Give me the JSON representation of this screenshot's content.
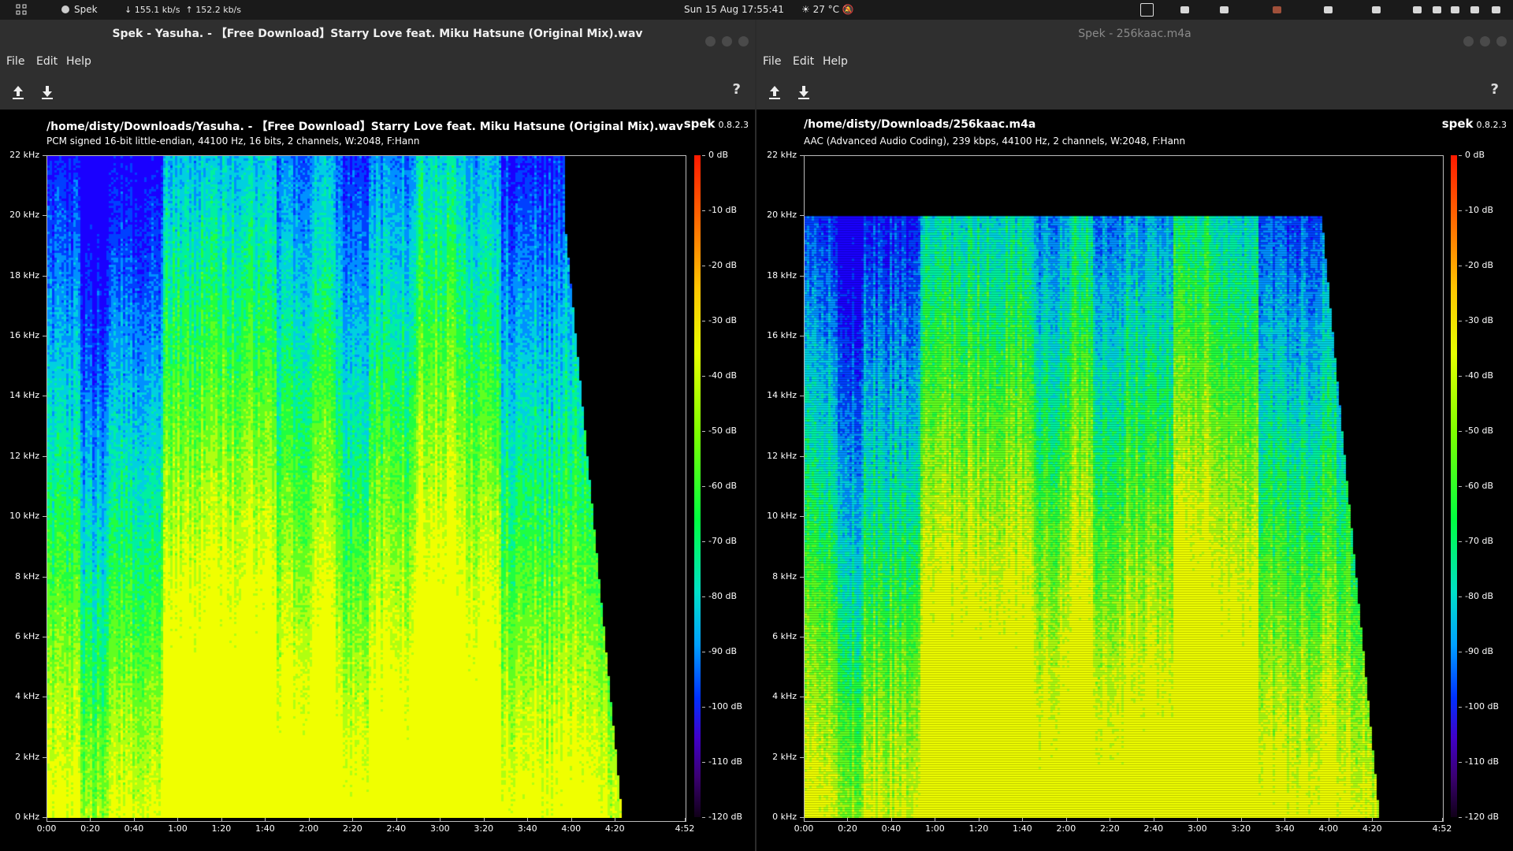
{
  "topbar": {
    "app": "Spek",
    "net_down": "155.1 kb/s",
    "net_up": "152.2 kb/s",
    "clock": "Sun 15 Aug  17:55:41",
    "weather": "27 °C"
  },
  "tray_icons": [
    "window-icon",
    "clipboard-icon",
    "chat-icon",
    "app-icon",
    "discord-icon",
    "home-icon",
    "display-icon",
    "bluetooth-icon",
    "volume-icon",
    "mic-icon",
    "power-icon"
  ],
  "menu": {
    "file": "File",
    "edit": "Edit",
    "help": "Help"
  },
  "windows": [
    {
      "title": "Spek - Yasuha. - 【Free Download】Starry Love feat. Miku Hatsune (Original Mix).wav",
      "active": true,
      "path": "/home/disty/Downloads/Yasuha. - 【Free Download】Starry Love feat. Miku Hatsune (Original Mix).wav",
      "meta": "PCM signed 16-bit little-endian, 44100 Hz, 16 bits, 2 channels, W:2048, F:Hann",
      "cutoff_khz": 22
    },
    {
      "title": "Spek - 256kaac.m4a",
      "active": false,
      "path": "/home/disty/Downloads/256kaac.m4a",
      "meta": "AAC (Advanced Audio Coding), 239 kbps, 44100 Hz, 2 channels, W:2048, F:Hann",
      "cutoff_khz": 20
    }
  ],
  "spek": {
    "name": "spek",
    "version": "0.8.2.3"
  },
  "chart_data": {
    "type": "heatmap",
    "y_ticks": [
      "22 kHz",
      "20 kHz",
      "18 kHz",
      "16 kHz",
      "14 kHz",
      "12 kHz",
      "10 kHz",
      "8 kHz",
      "6 kHz",
      "4 kHz",
      "2 kHz",
      "0 kHz"
    ],
    "x_ticks": [
      "0:00",
      "0:20",
      "0:40",
      "1:00",
      "1:20",
      "1:40",
      "2:00",
      "2:20",
      "2:40",
      "3:00",
      "3:20",
      "3:40",
      "4:00",
      "4:20",
      "4:52"
    ],
    "x_tick_seconds": [
      0,
      20,
      40,
      60,
      80,
      100,
      120,
      140,
      160,
      180,
      200,
      220,
      240,
      260,
      292
    ],
    "duration_seconds": 292,
    "audio_end_seconds": 262,
    "db_ticks": [
      "0 dB",
      "-10 dB",
      "-20 dB",
      "-30 dB",
      "-40 dB",
      "-50 dB",
      "-60 dB",
      "-70 dB",
      "-80 dB",
      "-90 dB",
      "-100 dB",
      "-110 dB",
      "-120 dB"
    ],
    "colors": {
      "loud": "#ffff00",
      "mid": "#00ff40",
      "quiet": "#0030ff",
      "silence": "#000000"
    }
  }
}
